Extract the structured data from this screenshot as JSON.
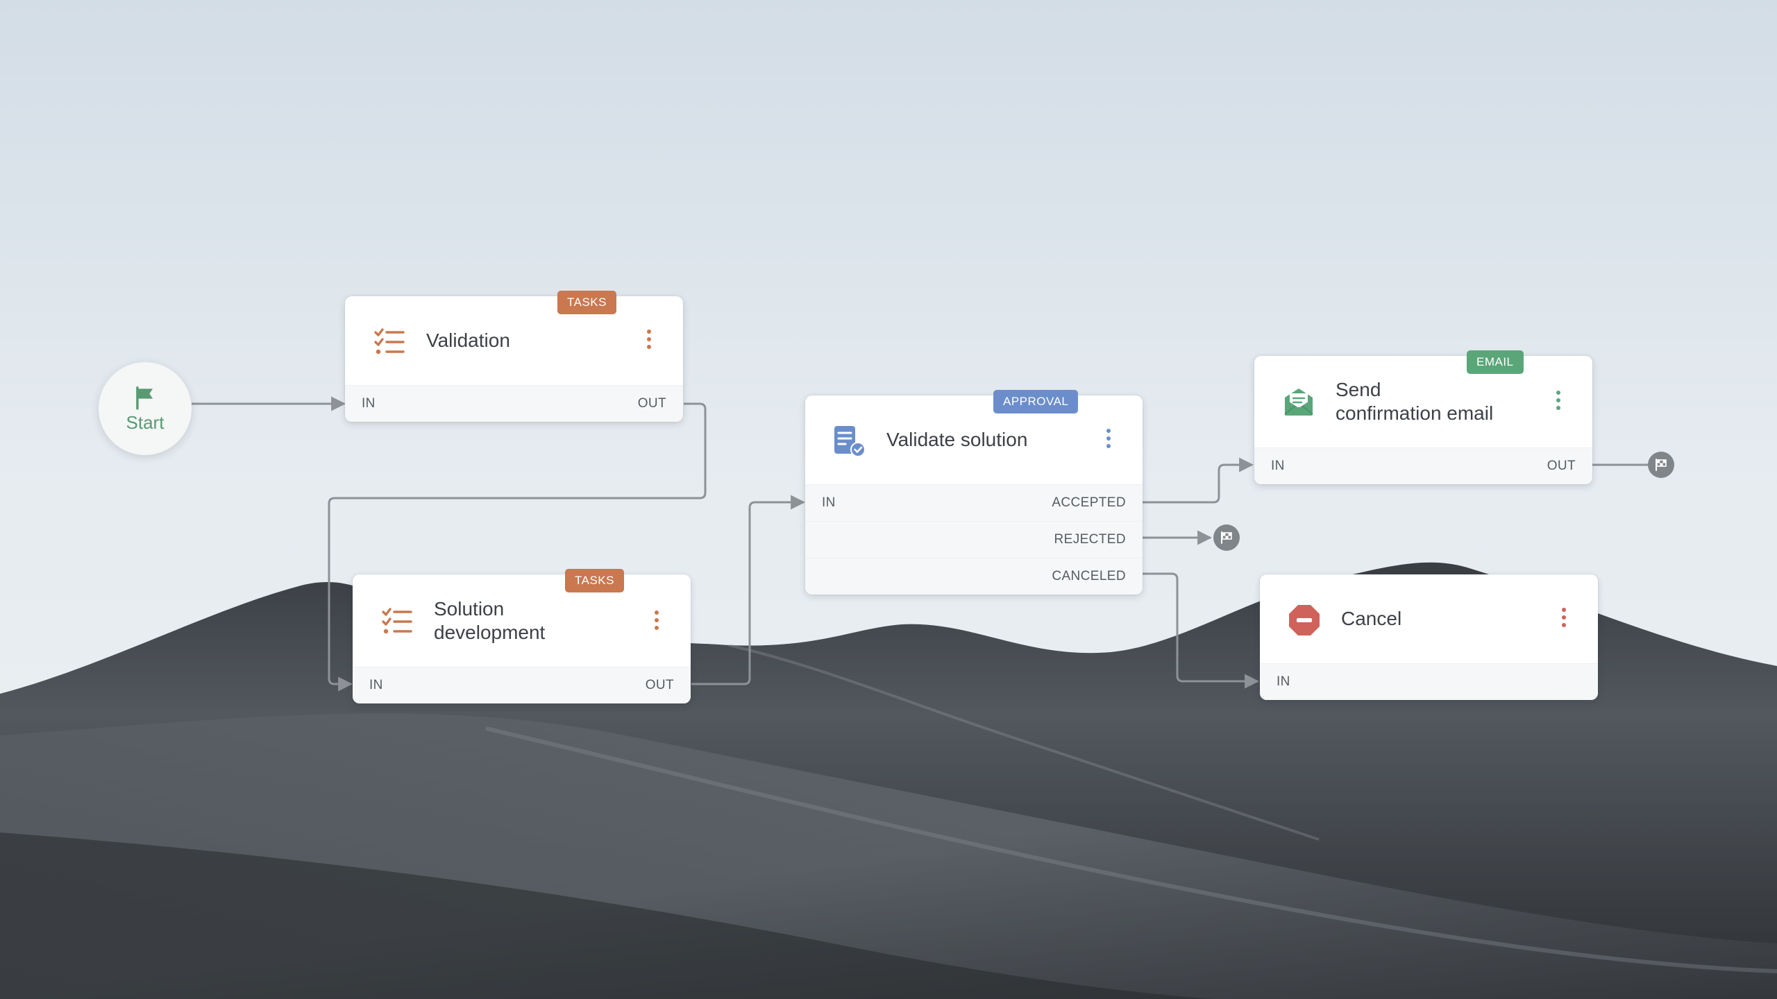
{
  "colors": {
    "tasks": "#c9784f",
    "approval": "#6b8ecb",
    "email": "#5aa679",
    "cancel": "#d0625c",
    "start": "#5a9a72",
    "wire": "#8e9297",
    "end_marker": "#80858a"
  },
  "start": {
    "label": "Start",
    "icon": "flag-icon"
  },
  "nodes": {
    "validation": {
      "badge": "TASKS",
      "title": "Validation",
      "icon": "checklist-icon",
      "ports": {
        "in": "IN",
        "out": "OUT"
      }
    },
    "solution_development": {
      "badge": "TASKS",
      "title": "Solution\ndevelopment",
      "icon": "checklist-icon",
      "ports": {
        "in": "IN",
        "out": "OUT"
      }
    },
    "validate_solution": {
      "badge": "APPROVAL",
      "title": "Validate solution",
      "icon": "document-check-icon",
      "ports": {
        "in": "IN",
        "accepted": "ACCEPTED",
        "rejected": "REJECTED",
        "canceled": "CANCELED"
      }
    },
    "send_email": {
      "badge": "EMAIL",
      "title": "Send\nconfirmation email",
      "icon": "open-envelope-icon",
      "ports": {
        "in": "IN",
        "out": "OUT"
      }
    },
    "cancel": {
      "title": "Cancel",
      "icon": "stop-sign-icon",
      "ports": {
        "in": "IN"
      }
    }
  },
  "end_markers": [
    "checkered-flag-icon",
    "checkered-flag-icon"
  ]
}
